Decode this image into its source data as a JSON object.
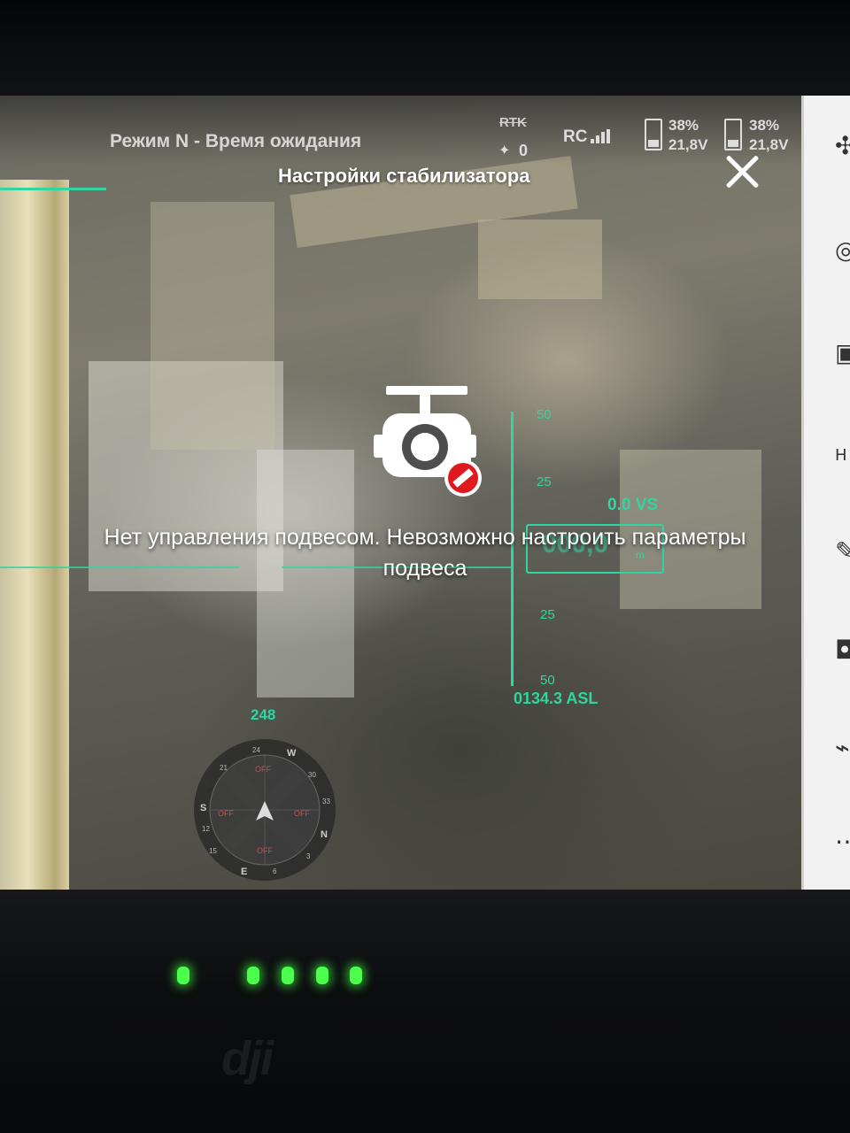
{
  "status_bar": {
    "mode_text": "Режим N - Время ожидания",
    "rtk_label": "RTK",
    "satellite_count": "0",
    "rc_label": "RC",
    "battery_1": {
      "percent": "38%",
      "voltage": "21,8V"
    },
    "battery_2": {
      "percent": "38%",
      "voltage": "21,8V"
    }
  },
  "dialog": {
    "title": "Настройки стабилизатора",
    "message": "Нет управления подвесом. Невозможно настроить параметры подвеса",
    "icon": "gimbal-disabled-icon"
  },
  "hud": {
    "alt_ticks": [
      "50",
      "25",
      "25",
      "50"
    ],
    "vertical_speed": "0.0  VS",
    "altitude_value": "000,0",
    "altitude_unit": "m",
    "asl": "0134.3 ASL",
    "heading": "248",
    "compass_labels": [
      "W",
      "S",
      "E",
      "N",
      "24",
      "21",
      "30",
      "33",
      "12",
      "15",
      "3",
      "6"
    ],
    "compass_zones": [
      "OFF",
      "OFF",
      "OFF",
      "OFF"
    ],
    "color": "#2fd6a0"
  },
  "side_icons": [
    "drone-icon",
    "settings-icon",
    "controller-icon",
    "hd-icon",
    "map-edit-icon",
    "camera-icon",
    "satellite-icon",
    "more-icon"
  ],
  "device": {
    "brand": "dji",
    "led_color": "#4dff4d"
  }
}
